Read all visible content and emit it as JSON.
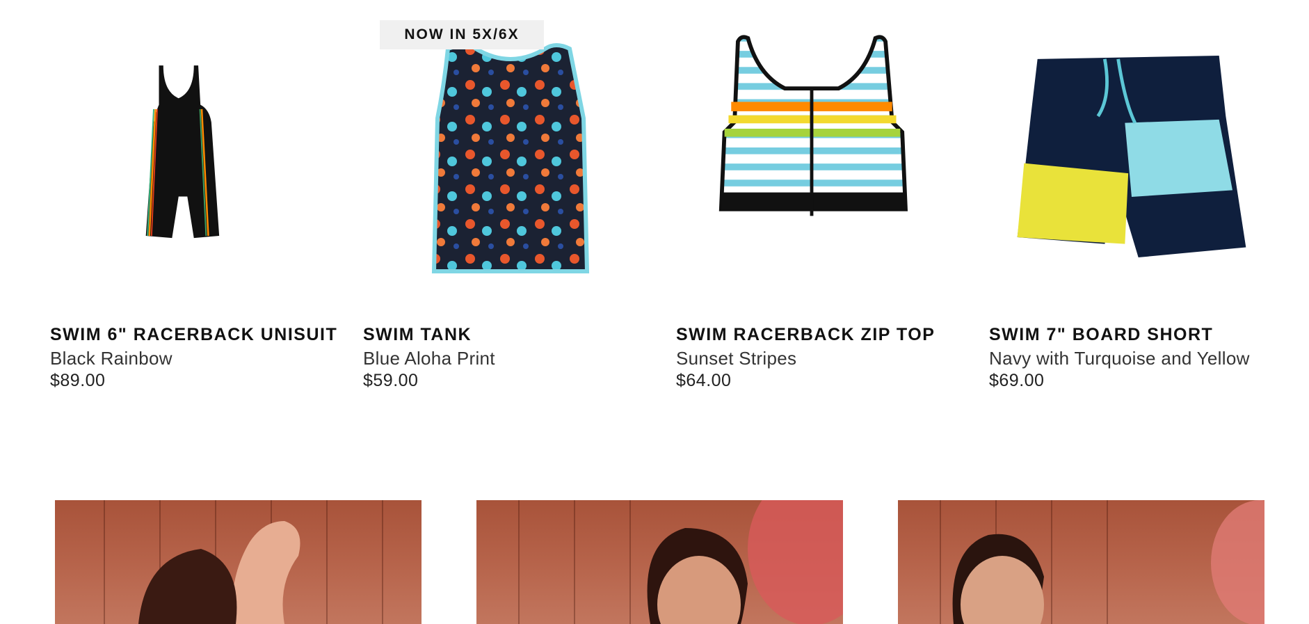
{
  "products": [
    {
      "name": "SWIM 6\" RACERBACK UNISUIT",
      "color": "Black Rainbow",
      "price": "$89.00",
      "image": "black-rainbow-unisuit-image"
    },
    {
      "name": "SWIM TANK",
      "color": "Blue Aloha Print",
      "price": "$59.00",
      "badge": "NOW IN 5X/6X",
      "image": "blue-aloha-tank-image"
    },
    {
      "name": "SWIM RACERBACK ZIP TOP",
      "color": "Sunset Stripes",
      "price": "$64.00",
      "image": "sunset-stripes-zip-top-image"
    },
    {
      "name": "SWIM 7\" BOARD SHORT",
      "color": "Navy with Turquoise and Yellow",
      "price": "$69.00",
      "image": "navy-turquoise-board-short-image"
    }
  ],
  "lifestyle_photos": [
    "lifestyle-photo-1",
    "lifestyle-photo-2",
    "lifestyle-photo-3"
  ],
  "colors": {
    "badge_bg": "#f0f0f0",
    "text": "#111111",
    "photo_tone": "#b0603f"
  }
}
